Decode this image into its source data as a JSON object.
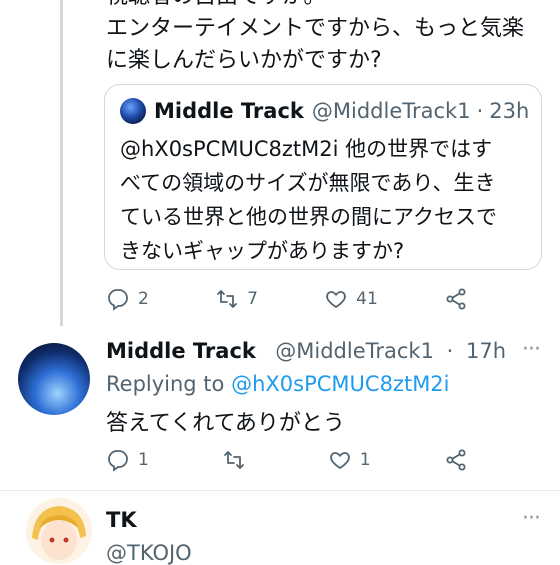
{
  "tweet_top": {
    "line0": "視聴者の自由ですか。",
    "line1": "エンターテイメントですから、もっと気楽",
    "line2": "に楽しんだらいかがですか?"
  },
  "quote": {
    "name": "Middle Track",
    "handle": "@MiddleTrack1",
    "sep": "·",
    "time": "23h",
    "lines": [
      "@hX0sPCMUC8ztM2i 他の世界ではす",
      "べての領域のサイズが無限であり、生き",
      "ている世界と他の世界の間にアクセスで",
      "きないギャップがありますか?"
    ]
  },
  "tweet_actions": {
    "replies": "2",
    "retweets": "7",
    "likes": "41"
  },
  "reply": {
    "name": "Middle Track",
    "handle": "@MiddleTrack1",
    "sep": "·",
    "time": "17h",
    "replying_label": "Replying to",
    "replying_handle": "@hX0sPCMUC8ztM2i",
    "body": "答えてくれてありがとう",
    "more": "···",
    "actions": {
      "replies": "1",
      "retweets": "",
      "likes": "1"
    }
  },
  "next_tweet": {
    "name": "TK",
    "handle": "@TKOJO",
    "more": "···"
  },
  "colors": {
    "text": "#0f1419",
    "muted": "#536471",
    "link": "#1d9bf0",
    "border": "#cfd9de"
  },
  "icons": [
    "reply-icon",
    "retweet-icon",
    "like-icon",
    "share-icon",
    "more-icon"
  ]
}
